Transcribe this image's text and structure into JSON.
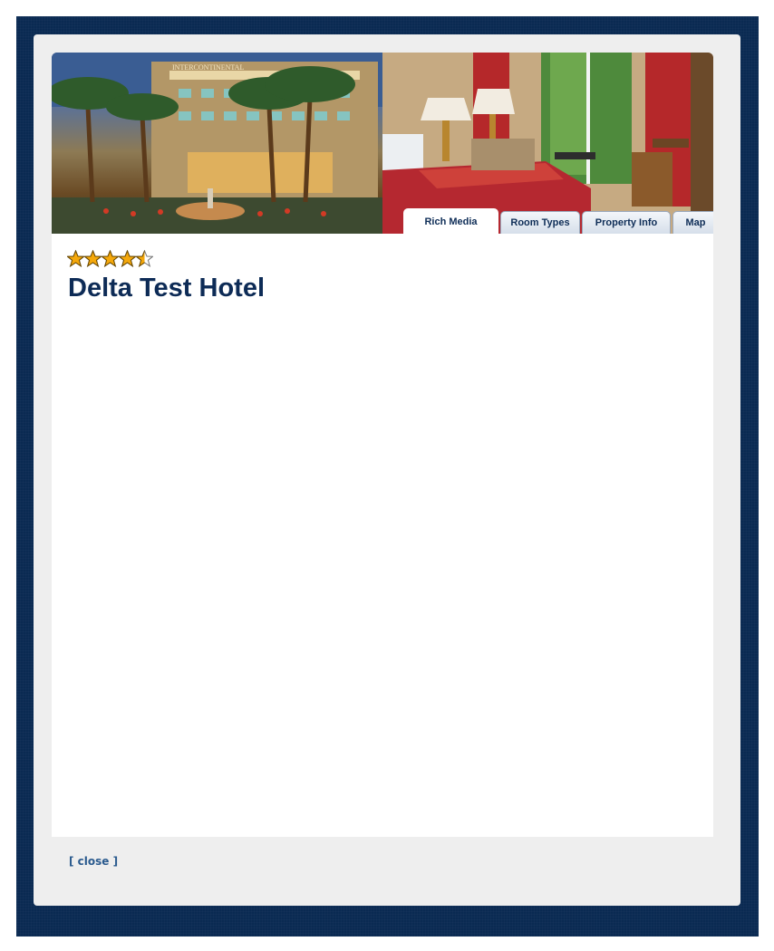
{
  "banner": {
    "left_photo": "hotel-exterior-photo",
    "left_sign": "INTERCONTINENTAL",
    "right_photo": "hotel-room-photo"
  },
  "tabs": [
    {
      "label": "Rich Media",
      "active": true
    },
    {
      "label": "Room Types",
      "active": false
    },
    {
      "label": "Property Info",
      "active": false
    },
    {
      "label": "Map",
      "active": false
    }
  ],
  "hotel": {
    "name": "Delta Test Hotel",
    "rating": 4.5,
    "rating_max": 5
  },
  "footer": {
    "close_label": "[ close ]"
  },
  "colors": {
    "frame": "#0a2a52",
    "panel": "#eeeeee",
    "title": "#0d2b56",
    "star_fill": "#f5a80b",
    "link": "#2a5a8e"
  }
}
